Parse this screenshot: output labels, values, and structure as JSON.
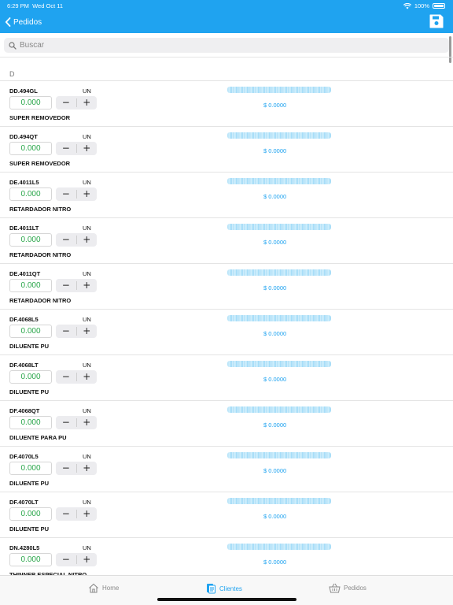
{
  "status": {
    "time": "6:29 PM",
    "date": "Wed Oct 11",
    "battery": "100%"
  },
  "nav": {
    "back_label": "Pedidos"
  },
  "search": {
    "placeholder": "Buscar"
  },
  "section_header": "D",
  "items": [
    {
      "code": "DD.494GL",
      "unit": "UN",
      "qty": "0.000",
      "desc": "SUPER REMOVEDOR",
      "price": "$ 0.0000"
    },
    {
      "code": "DD.494QT",
      "unit": "UN",
      "qty": "0.000",
      "desc": "SUPER REMOVEDOR",
      "price": "$ 0.0000"
    },
    {
      "code": "DE.4011L5",
      "unit": "UN",
      "qty": "0.000",
      "desc": "RETARDADOR NITRO",
      "price": "$ 0.0000"
    },
    {
      "code": "DE.4011LT",
      "unit": "UN",
      "qty": "0.000",
      "desc": "RETARDADOR NITRO",
      "price": "$ 0.0000"
    },
    {
      "code": "DE.4011QT",
      "unit": "UN",
      "qty": "0.000",
      "desc": "RETARDADOR NITRO",
      "price": "$ 0.0000"
    },
    {
      "code": "DF.4068L5",
      "unit": "UN",
      "qty": "0.000",
      "desc": "DILUENTE PU",
      "price": "$ 0.0000"
    },
    {
      "code": "DF.4068LT",
      "unit": "UN",
      "qty": "0.000",
      "desc": "DILUENTE PU",
      "price": "$ 0.0000"
    },
    {
      "code": "DF.4068QT",
      "unit": "UN",
      "qty": "0.000",
      "desc": "DILUENTE PARA PU",
      "price": "$ 0.0000"
    },
    {
      "code": "DF.4070L5",
      "unit": "UN",
      "qty": "0.000",
      "desc": "DILUENTE PU",
      "price": "$ 0.0000"
    },
    {
      "code": "DF.4070LT",
      "unit": "UN",
      "qty": "0.000",
      "desc": "DILUENTE PU",
      "price": "$ 0.0000"
    },
    {
      "code": "DN.4280L5",
      "unit": "UN",
      "qty": "0.000",
      "desc": "THINNER ESPECIAL NITRO",
      "price": "$ 0.0000"
    }
  ],
  "stepper": {
    "minus": "−",
    "plus": "+"
  },
  "tabs": [
    {
      "label": "Home",
      "icon": "home-icon",
      "active": false
    },
    {
      "label": "Clientes",
      "icon": "clients-icon",
      "active": true
    },
    {
      "label": "Pedidos",
      "icon": "basket-icon",
      "active": false
    }
  ],
  "colors": {
    "accent": "#1fa3f0",
    "qty_green": "#2aa64a"
  }
}
